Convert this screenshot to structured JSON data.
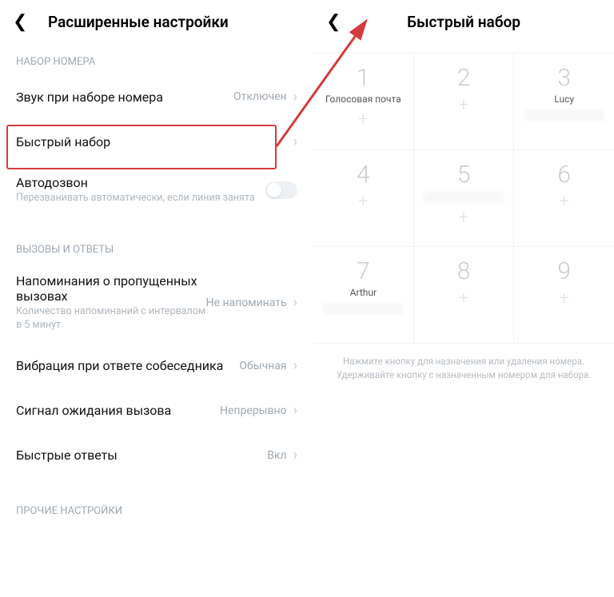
{
  "left": {
    "title": "Расширенные настройки",
    "section_dial": "НАБОР НОМЕРА",
    "row_sound": {
      "label": "Звук при наборе номера",
      "value": "Отключен"
    },
    "row_speed": {
      "label": "Быстрый набор"
    },
    "row_redial": {
      "label": "Автодозвон",
      "sub": "Перезванивать автоматически, если линия занята"
    },
    "section_calls": "ВЫЗОВЫ И ОТВЕТЫ",
    "row_missed": {
      "label": "Напоминания о пропущенных вызовах",
      "sub": "Количество напоминаний с интервалом в 5 минут",
      "value": "Не напоминать"
    },
    "row_vibrate": {
      "label": "Вибрация при ответе собеседника",
      "value": "Обычная"
    },
    "row_wait": {
      "label": "Сигнал ожидания вызова",
      "value": "Непрерывно"
    },
    "row_quick": {
      "label": "Быстрые ответы",
      "value": "Вкл"
    },
    "section_other": "ПРОЧИЕ НАСТРОЙКИ"
  },
  "right": {
    "title": "Быстрый набор",
    "keys": {
      "k1": {
        "digit": "1",
        "label": "Голосовая почта"
      },
      "k2": {
        "digit": "2"
      },
      "k3": {
        "digit": "3",
        "label": "Lucy"
      },
      "k4": {
        "digit": "4"
      },
      "k5": {
        "digit": "5"
      },
      "k6": {
        "digit": "6"
      },
      "k7": {
        "digit": "7",
        "label": "Arthur"
      },
      "k8": {
        "digit": "8"
      },
      "k9": {
        "digit": "9"
      }
    },
    "hint1": "Нажмите кнопку для назначения или удаления номера.",
    "hint2": "Удерживайте кнопку с назначенным номером для набора."
  }
}
